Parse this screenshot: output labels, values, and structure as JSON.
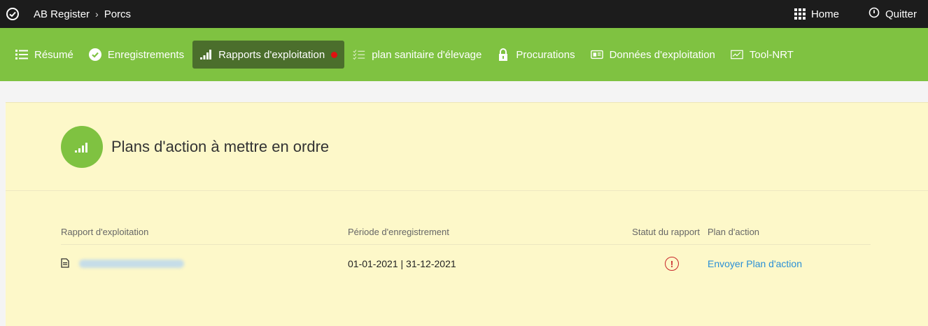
{
  "topbar": {
    "app_name": "AB Register",
    "separator": "›",
    "section": "Porcs",
    "home_label": "Home",
    "logout_label": "Quitter"
  },
  "nav": {
    "items": [
      {
        "label": "Résumé",
        "icon": "list-icon"
      },
      {
        "label": "Enregistrements",
        "icon": "check-circle-icon"
      },
      {
        "label": "Rapports d'exploitation",
        "icon": "signal-bars-icon",
        "active": true,
        "notification": true
      },
      {
        "label": "plan sanitaire d'élevage",
        "icon": "checklist-icon"
      },
      {
        "label": "Procurations",
        "icon": "lock-icon"
      },
      {
        "label": "Données d'exploitation",
        "icon": "id-card-icon"
      },
      {
        "label": "Tool-NRT",
        "icon": "chart-line-icon"
      }
    ]
  },
  "card": {
    "title": "Plans d'action à mettre en ordre"
  },
  "table": {
    "headers": [
      "Rapport d'exploitation",
      "Période d'enregistrement",
      "Statut du rapport",
      "Plan d'action"
    ],
    "rows": [
      {
        "report": "",
        "period": "01-01-2021 | 31-12-2021",
        "status_icon": "warning-circle-icon",
        "action": "Envoyer Plan d'action"
      }
    ]
  },
  "colors": {
    "topbar": "#1c1c1c",
    "nav_green": "#7fc241",
    "nav_active": "#4b6e2c",
    "card_bg": "#fdf8c9",
    "link": "#2a8fd6",
    "warning": "#c8272b"
  }
}
